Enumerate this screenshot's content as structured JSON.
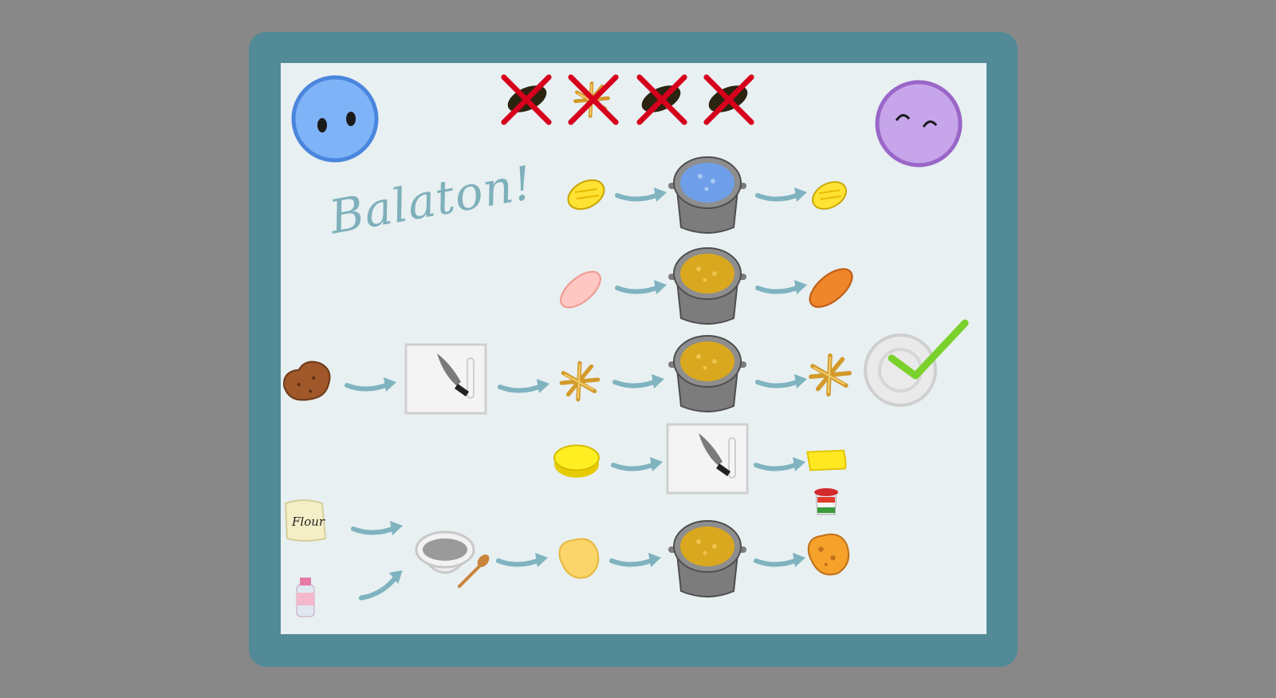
{
  "game": {
    "title_script": "Balaton!",
    "flour_label": "Flour"
  },
  "players": {
    "left": {
      "name": "blue-player",
      "color": "#7fb3f7",
      "border": "#4a86dd",
      "mood": "neutral"
    },
    "right": {
      "name": "purple-player",
      "color": "#c6a5ea",
      "border": "#9a66c8",
      "mood": "happy"
    }
  },
  "strikes": {
    "total": 4,
    "items": [
      "burnt-food-1",
      "burnt-food-2",
      "burnt-food-3",
      "burnt-food-4"
    ]
  },
  "recipe_rows": [
    {
      "name": "corn",
      "input": "corn-icon",
      "station": "pot-water",
      "output": "cooked-corn-icon"
    },
    {
      "name": "carrot",
      "input": "raw-carrot-icon",
      "station": "pot-broth",
      "output": "cooked-carrot-icon"
    },
    {
      "name": "potato",
      "input": "potato-icon",
      "mid_station": "cutting-board",
      "mid_output": "potato-strips-icon",
      "station": "pot-broth",
      "output": "cooked-strips-icon",
      "status": "complete"
    },
    {
      "name": "cheese",
      "input": "cheese-icon",
      "station": "cutting-board",
      "output": "cheese-slice-icon"
    },
    {
      "name": "dumpling",
      "inputs": [
        "flour-bag-icon",
        "water-bottle-icon"
      ],
      "mid_station": "mixing-bowl",
      "mid_output": "dough-icon",
      "station": "pot-broth",
      "output": "fried-dumpling-icon",
      "garnish": "paprika-jar-icon"
    }
  ],
  "colors": {
    "arrow": "#7fb3bf",
    "pot": "#7c7c7c",
    "water": "#6f9fe8",
    "broth": "#d9a81e",
    "strike": "#d6001c",
    "check": "#7ad12b"
  }
}
